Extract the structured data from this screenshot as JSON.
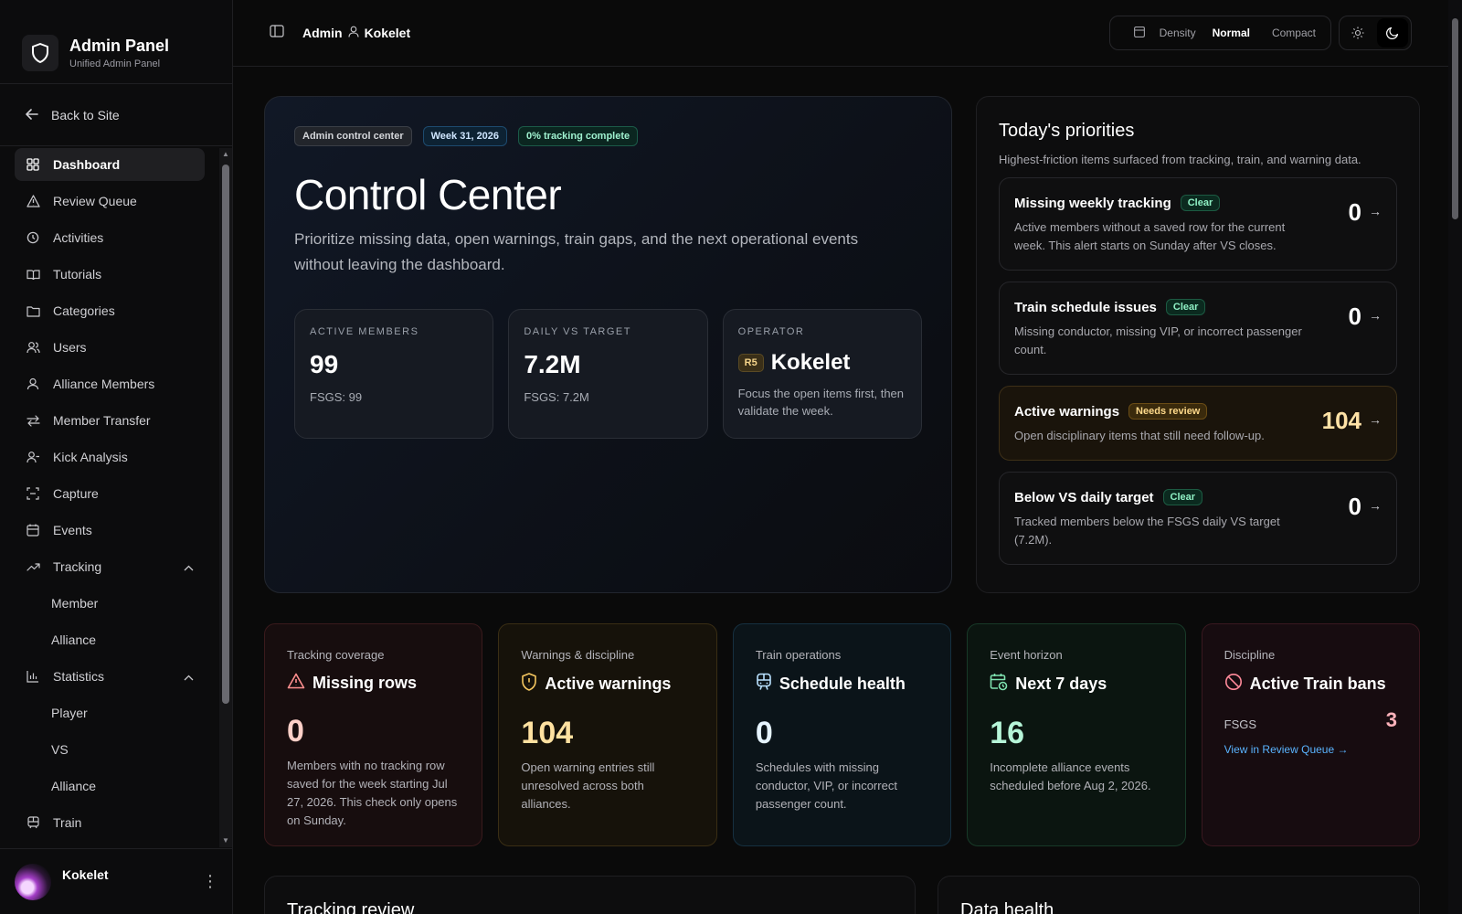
{
  "brand": {
    "title": "Admin Panel",
    "subtitle": "Unified Admin Panel"
  },
  "back_label": "Back to Site",
  "nav": [
    {
      "label": "Dashboard",
      "icon": "grid-icon",
      "active": true
    },
    {
      "label": "Review Queue",
      "icon": "alert-icon"
    },
    {
      "label": "Activities",
      "icon": "history-icon"
    },
    {
      "label": "Tutorials",
      "icon": "book-icon"
    },
    {
      "label": "Categories",
      "icon": "folder-icon"
    },
    {
      "label": "Users",
      "icon": "users-icon"
    },
    {
      "label": "Alliance Members",
      "icon": "members-icon"
    },
    {
      "label": "Member Transfer",
      "icon": "transfer-icon"
    },
    {
      "label": "Kick Analysis",
      "icon": "kick-icon"
    },
    {
      "label": "Capture",
      "icon": "capture-icon"
    },
    {
      "label": "Events",
      "icon": "calendar-icon"
    },
    {
      "label": "Tracking",
      "icon": "trend-icon",
      "expanded": true
    },
    {
      "label": "Member",
      "sub": true
    },
    {
      "label": "Alliance",
      "sub": true
    },
    {
      "label": "Statistics",
      "icon": "bar-chart-icon",
      "expanded": true
    },
    {
      "label": "Player",
      "sub": true
    },
    {
      "label": "VS",
      "sub": true
    },
    {
      "label": "Alliance",
      "sub": true
    },
    {
      "label": "Train",
      "icon": "train-icon"
    }
  ],
  "user": {
    "name": "Kokelet"
  },
  "header": {
    "crumb_root": "Admin",
    "crumb_user": "Kokelet",
    "density_label": "Density",
    "density_options": [
      "Normal",
      "Compact"
    ],
    "density_selected": "Normal"
  },
  "hero": {
    "badges": [
      "Admin control center",
      "Week 31, 2026",
      "0% tracking complete"
    ],
    "title": "Control Center",
    "description": "Prioritize missing data, open warnings, train gaps, and the next operational events without leaving the dashboard.",
    "stats": [
      {
        "label": "ACTIVE MEMBERS",
        "value": "99",
        "sub": "FSGS: 99"
      },
      {
        "label": "DAILY VS TARGET",
        "value": "7.2M",
        "sub": "FSGS: 7.2M"
      },
      {
        "label": "OPERATOR",
        "rank": "R5",
        "value": "Kokelet",
        "sub": "Focus the open items first, then validate the week."
      }
    ]
  },
  "priorities": {
    "title": "Today's priorities",
    "subtitle": "Highest-friction items surfaced from tracking, train, and warning data.",
    "items": [
      {
        "title": "Missing weekly tracking",
        "tag": "Clear",
        "desc": "Active members without a saved row for the current week. This alert starts on Sunday after VS closes.",
        "count": "0"
      },
      {
        "title": "Train schedule issues",
        "tag": "Clear",
        "desc": "Missing conductor, missing VIP, or incorrect passenger count.",
        "count": "0"
      },
      {
        "title": "Active warnings",
        "tag": "Needs review",
        "desc": "Open disciplinary items that still need follow-up.",
        "count": "104"
      },
      {
        "title": "Below VS daily target",
        "tag": "Clear",
        "desc": "Tracked members below the FSGS daily VS target (7.2M).",
        "count": "0"
      }
    ]
  },
  "cards": [
    {
      "eyebrow": "Tracking coverage",
      "title": "Missing rows",
      "icon": "warning-triangle-icon",
      "value": "0",
      "desc": "Members with no tracking row saved for the week starting Jul 27, 2026. This check only opens on Sunday.",
      "color": "#ffd0c8"
    },
    {
      "eyebrow": "Warnings & discipline",
      "title": "Active warnings",
      "icon": "shield-alert-icon",
      "value": "104",
      "desc": "Open warning entries still unresolved across both alliances.",
      "color": "#ffe1a0"
    },
    {
      "eyebrow": "Train operations",
      "title": "Schedule health",
      "icon": "train-icon",
      "value": "0",
      "desc": "Schedules with missing conductor, VIP, or incorrect passenger count.",
      "color": "#e6f4ff"
    },
    {
      "eyebrow": "Event horizon",
      "title": "Next 7 days",
      "icon": "calendar-clock-icon",
      "value": "16",
      "desc": "Incomplete alliance events scheduled before Aug 2, 2026.",
      "color": "#b6f5d8"
    },
    {
      "eyebrow": "Discipline",
      "title": "Active Train bans",
      "icon": "ban-icon",
      "ban_label": "FSGS",
      "ban_value": "3",
      "link": "View in Review Queue →"
    }
  ],
  "bottom": {
    "left_title": "Tracking review",
    "right_title": "Data health"
  }
}
